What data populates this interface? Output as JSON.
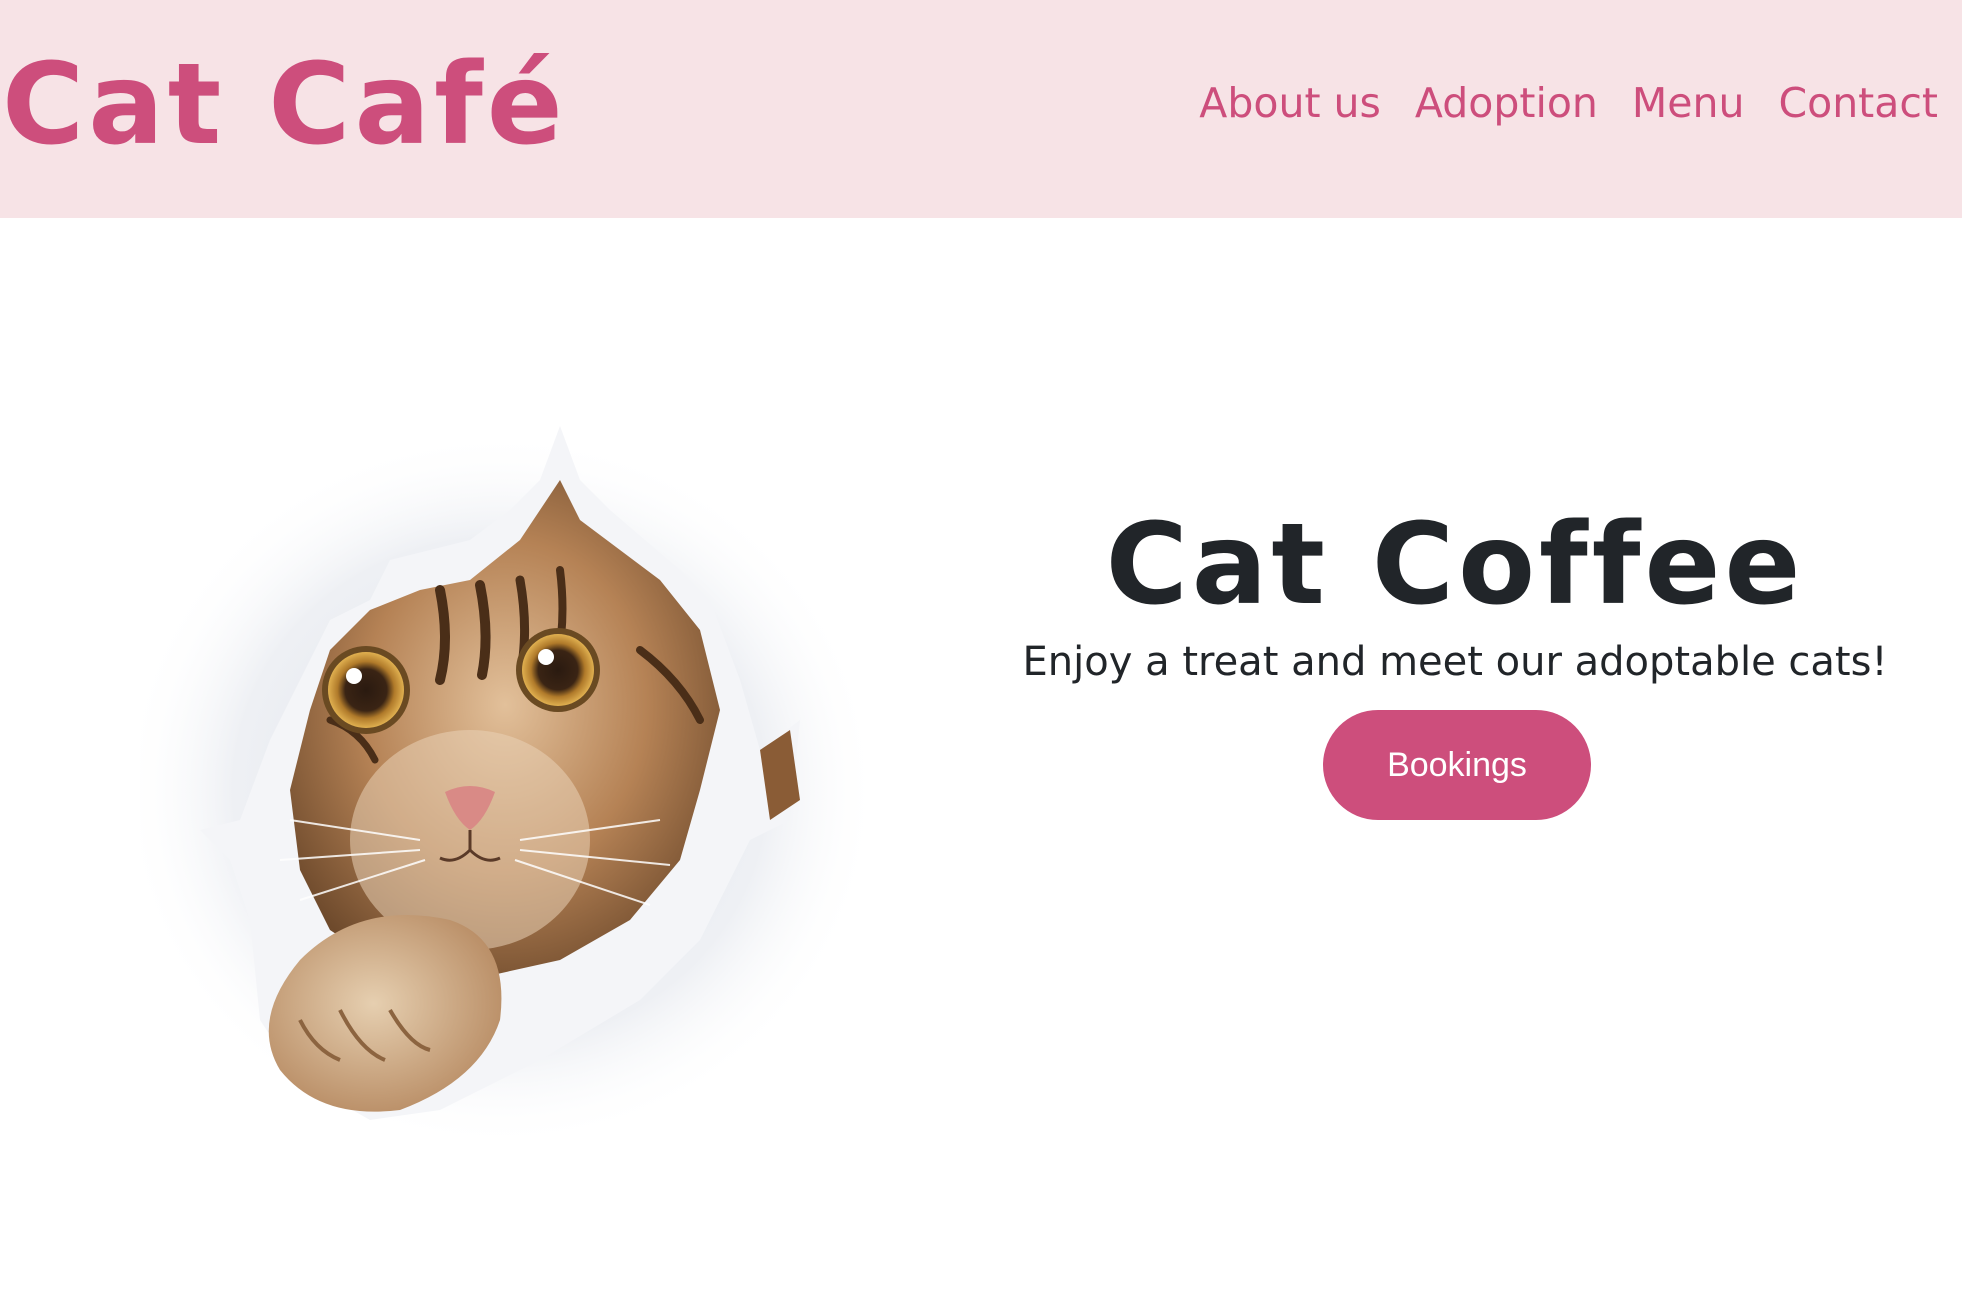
{
  "header": {
    "logo": "Cat Café",
    "nav": [
      {
        "label": "About us"
      },
      {
        "label": "Adoption"
      },
      {
        "label": "Menu"
      },
      {
        "label": "Contact"
      }
    ]
  },
  "hero": {
    "title": "Cat Coffee",
    "subtitle": "Enjoy a treat and meet our adoptable cats!",
    "button_label": "Bookings"
  },
  "colors": {
    "brand_pink": "#cd4e7c",
    "header_bg": "#f7e3e6",
    "text_dark": "#212529"
  }
}
